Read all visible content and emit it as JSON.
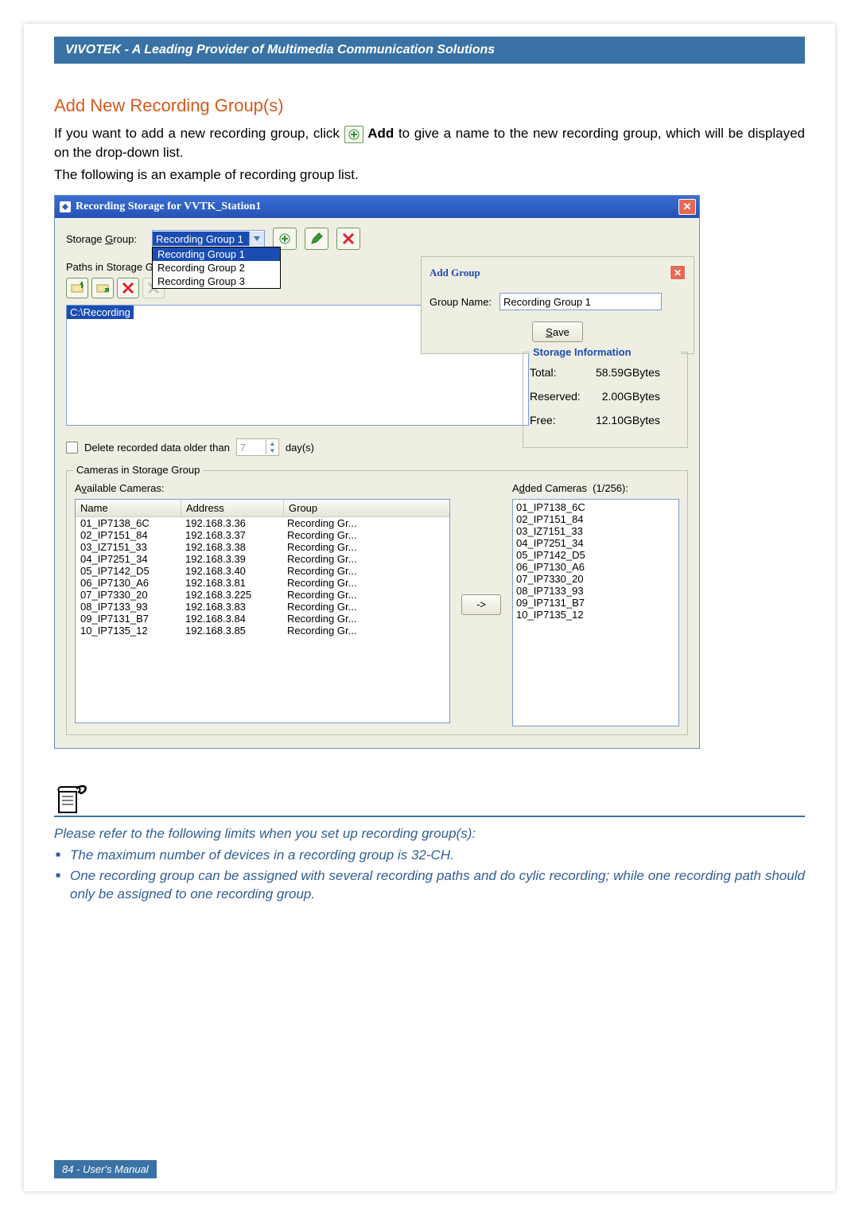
{
  "header": "VIVOTEK - A Leading Provider of Multimedia Communication Solutions",
  "section_title": "Add New Recording Group(s)",
  "para1_a": "If you want to add a new recording group, click ",
  "para1_b": " Add",
  "para1_c": " to give a name to the new recording group, which will be displayed on the drop-down list.",
  "para2": "The following is an example of recording group list.",
  "window": {
    "title": "Recording Storage for VVTK_Station1",
    "storage_group_label": "Storage Group:",
    "storage_group_selected": "Recording Group 1",
    "dropdown": [
      "Recording Group 1",
      "Recording Group 2",
      "Recording Group 3"
    ],
    "paths_label": "Paths in Storage Group:",
    "path_selected": "C:\\Recording",
    "add_group": {
      "title": "Add Group",
      "name_label": "Group Name:",
      "name_value": "Recording Group 1",
      "save": "Save",
      "save_u": "S"
    },
    "storage_info": {
      "title": "Storage Information",
      "rows": [
        {
          "l": "Total:",
          "v": "58.59",
          "u": "GBytes"
        },
        {
          "l": "Reserved:",
          "v": "2.00",
          "u": "GBytes"
        },
        {
          "l": "Free:",
          "v": "12.10",
          "u": "GBytes"
        }
      ]
    },
    "delete_label": "Delete recorded data older than",
    "delete_days": "7",
    "delete_unit": "day(s)",
    "cameras": {
      "legend": "Cameras in Storage Group",
      "avail_label": "Available Cameras:",
      "avail_u": "v",
      "added_label": "Added Cameras  (1/256):",
      "added_u": "d",
      "headers": {
        "name": "Name",
        "address": "Address",
        "group": "Group"
      },
      "rows": [
        {
          "n": "01_IP7138_6C",
          "a": "192.168.3.36",
          "g": "Recording Gr..."
        },
        {
          "n": "02_IP7151_84",
          "a": "192.168.3.37",
          "g": "Recording Gr..."
        },
        {
          "n": "03_IZ7151_33",
          "a": "192.168.3.38",
          "g": "Recording Gr..."
        },
        {
          "n": "04_IP7251_34",
          "a": "192.168.3.39",
          "g": "Recording Gr..."
        },
        {
          "n": "05_IP7142_D5",
          "a": "192.168.3.40",
          "g": "Recording Gr..."
        },
        {
          "n": "06_IP7130_A6",
          "a": "192.168.3.81",
          "g": "Recording Gr..."
        },
        {
          "n": "07_IP7330_20",
          "a": "192.168.3.225",
          "g": "Recording Gr..."
        },
        {
          "n": "08_IP7133_93",
          "a": "192.168.3.83",
          "g": "Recording Gr..."
        },
        {
          "n": "09_IP7131_B7",
          "a": "192.168.3.84",
          "g": "Recording Gr..."
        },
        {
          "n": "10_IP7135_12",
          "a": "192.168.3.85",
          "g": "Recording Gr..."
        }
      ],
      "added": [
        "01_IP7138_6C",
        "02_IP7151_84",
        "03_IZ7151_33",
        "04_IP7251_34",
        "05_IP7142_D5",
        "06_IP7130_A6",
        "07_IP7330_20",
        "08_IP7133_93",
        "09_IP7131_B7",
        "10_IP7135_12"
      ],
      "move_btn": "->"
    }
  },
  "note": {
    "intro": "Please refer to the following limits when you set up recording group(s):",
    "b1": "The maximum number of devices in a recording group is 32-CH.",
    "b2": "One recording group can be assigned with several recording paths and do cylic recording; while one recording path should only be assigned to one recording group."
  },
  "footer": "84 - User's Manual"
}
